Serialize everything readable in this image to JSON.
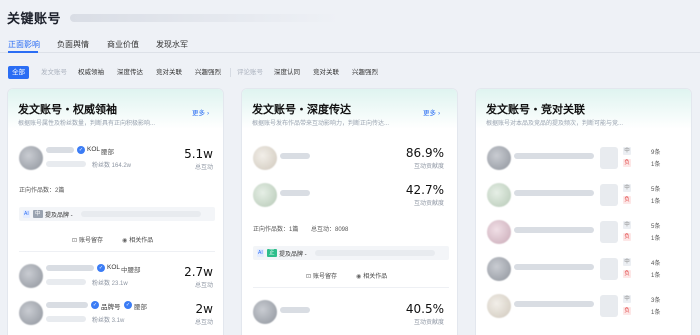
{
  "header": {
    "title": "关键账号"
  },
  "tabs": [
    {
      "label": "正面影响"
    },
    {
      "label": "负面舆情"
    },
    {
      "label": "商业价值"
    },
    {
      "label": "发现水军"
    }
  ],
  "filters": {
    "all": "全部",
    "group1_label": "发文账号",
    "group1": [
      "权威领袖",
      "深度传达",
      "竞对关联",
      "兴趣强烈"
    ],
    "group2_label": "评论账号",
    "group2": [
      "深度认同",
      "竞对关联",
      "兴趣强烈"
    ]
  },
  "cards": [
    {
      "title": "发文账号・权威领袖",
      "subtitle": "根据账号属性及粉丝数量，判断具有正向积极影响...",
      "more": "更多",
      "items": [
        {
          "tag": "KOL",
          "level": "腰部",
          "fans": "粉丝数 164.2w",
          "value": "5.1w",
          "value_label": "总互动"
        },
        {
          "tag": "KOL",
          "level": "中腰部",
          "fans": "粉丝数 23.1w",
          "value": "2.7w",
          "value_label": "总互动"
        },
        {
          "tag": "品牌号",
          "level": "腰部",
          "fans": "粉丝数 3.1w",
          "value": "2w",
          "value_label": "总互动"
        }
      ],
      "works_info": "正向作品数：2篇",
      "brand": {
        "ai": "AI",
        "sentiment": "中",
        "text": "提及品牌 -"
      },
      "actions": [
        "账号留存",
        "相关作品"
      ]
    },
    {
      "title": "发文账号・深度传达",
      "subtitle": "根据账号发布作品带来互动影响力，判断正向传达...",
      "more": "更多",
      "items": [
        {
          "value": "86.9%",
          "value_label": "互动贡献度"
        },
        {
          "value": "42.7%",
          "value_label": "互动贡献度"
        },
        {
          "value": "40.5%",
          "value_label": "互动贡献度"
        }
      ],
      "works_info": "正向作品数：1篇",
      "works_total": "总互动：8098",
      "brand": {
        "ai": "AI",
        "sentiment": "正",
        "text": "提及品牌 -"
      },
      "actions": [
        "账号留存",
        "相关作品"
      ]
    },
    {
      "title": "发文账号・竞对关联",
      "subtitle": "根据账号对本品及竞品的提及频次，判断可能与竞...",
      "more": "更多",
      "items": [
        {
          "rows": [
            {
              "s": "中",
              "c": "9条"
            },
            {
              "s": "负",
              "c": "1条"
            }
          ]
        },
        {
          "rows": [
            {
              "s": "中",
              "c": "5条"
            },
            {
              "s": "负",
              "c": "1条"
            }
          ]
        },
        {
          "rows": [
            {
              "s": "中",
              "c": "5条"
            },
            {
              "s": "负",
              "c": "1条"
            }
          ]
        },
        {
          "rows": [
            {
              "s": "中",
              "c": "4条"
            },
            {
              "s": "负",
              "c": "1条"
            }
          ]
        },
        {
          "rows": [
            {
              "s": "中",
              "c": "3条"
            },
            {
              "s": "负",
              "c": "1条"
            }
          ]
        }
      ]
    }
  ],
  "colors": {
    "accent": "#2a6df4",
    "positive": "#2ebd8b",
    "negative": "#e24b4b",
    "head_tint": "#dff4f0"
  },
  "icons": {
    "more": "chevron-right-icon",
    "kol": "kol-badge-icon",
    "retain": "save-icon",
    "works": "eye-icon"
  }
}
